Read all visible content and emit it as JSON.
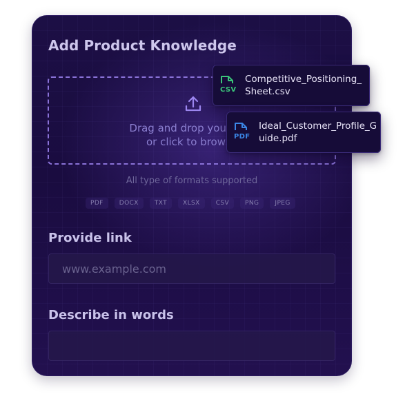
{
  "card": {
    "title": "Add Product Knowledge"
  },
  "dropzone": {
    "line1": "Drag and drop your mat",
    "line2": "or click to browse",
    "formats_note": "All type of formats supported",
    "formats": [
      "PDF",
      "DOCX",
      "TXT",
      "XLSX",
      "CSV",
      "PNG",
      "JPEG"
    ]
  },
  "link": {
    "label": "Provide link",
    "placeholder": "www.example.com",
    "value": ""
  },
  "describe": {
    "label": "Describe in words",
    "value": ""
  },
  "files": [
    {
      "tag": "CSV",
      "name": "Competitive_Positioning_Sheet.csv",
      "icon": "csv-file-icon",
      "color": "#3bc57a"
    },
    {
      "tag": "PDF",
      "name": "Ideal_Customer_Profile_Guide.pdf",
      "icon": "pdf-file-icon",
      "color": "#3b86e6"
    }
  ],
  "colors": {
    "card_bg": "#1c0f45",
    "accent": "#8a72d8",
    "csv": "#3bc57a",
    "pdf": "#3b86e6"
  }
}
